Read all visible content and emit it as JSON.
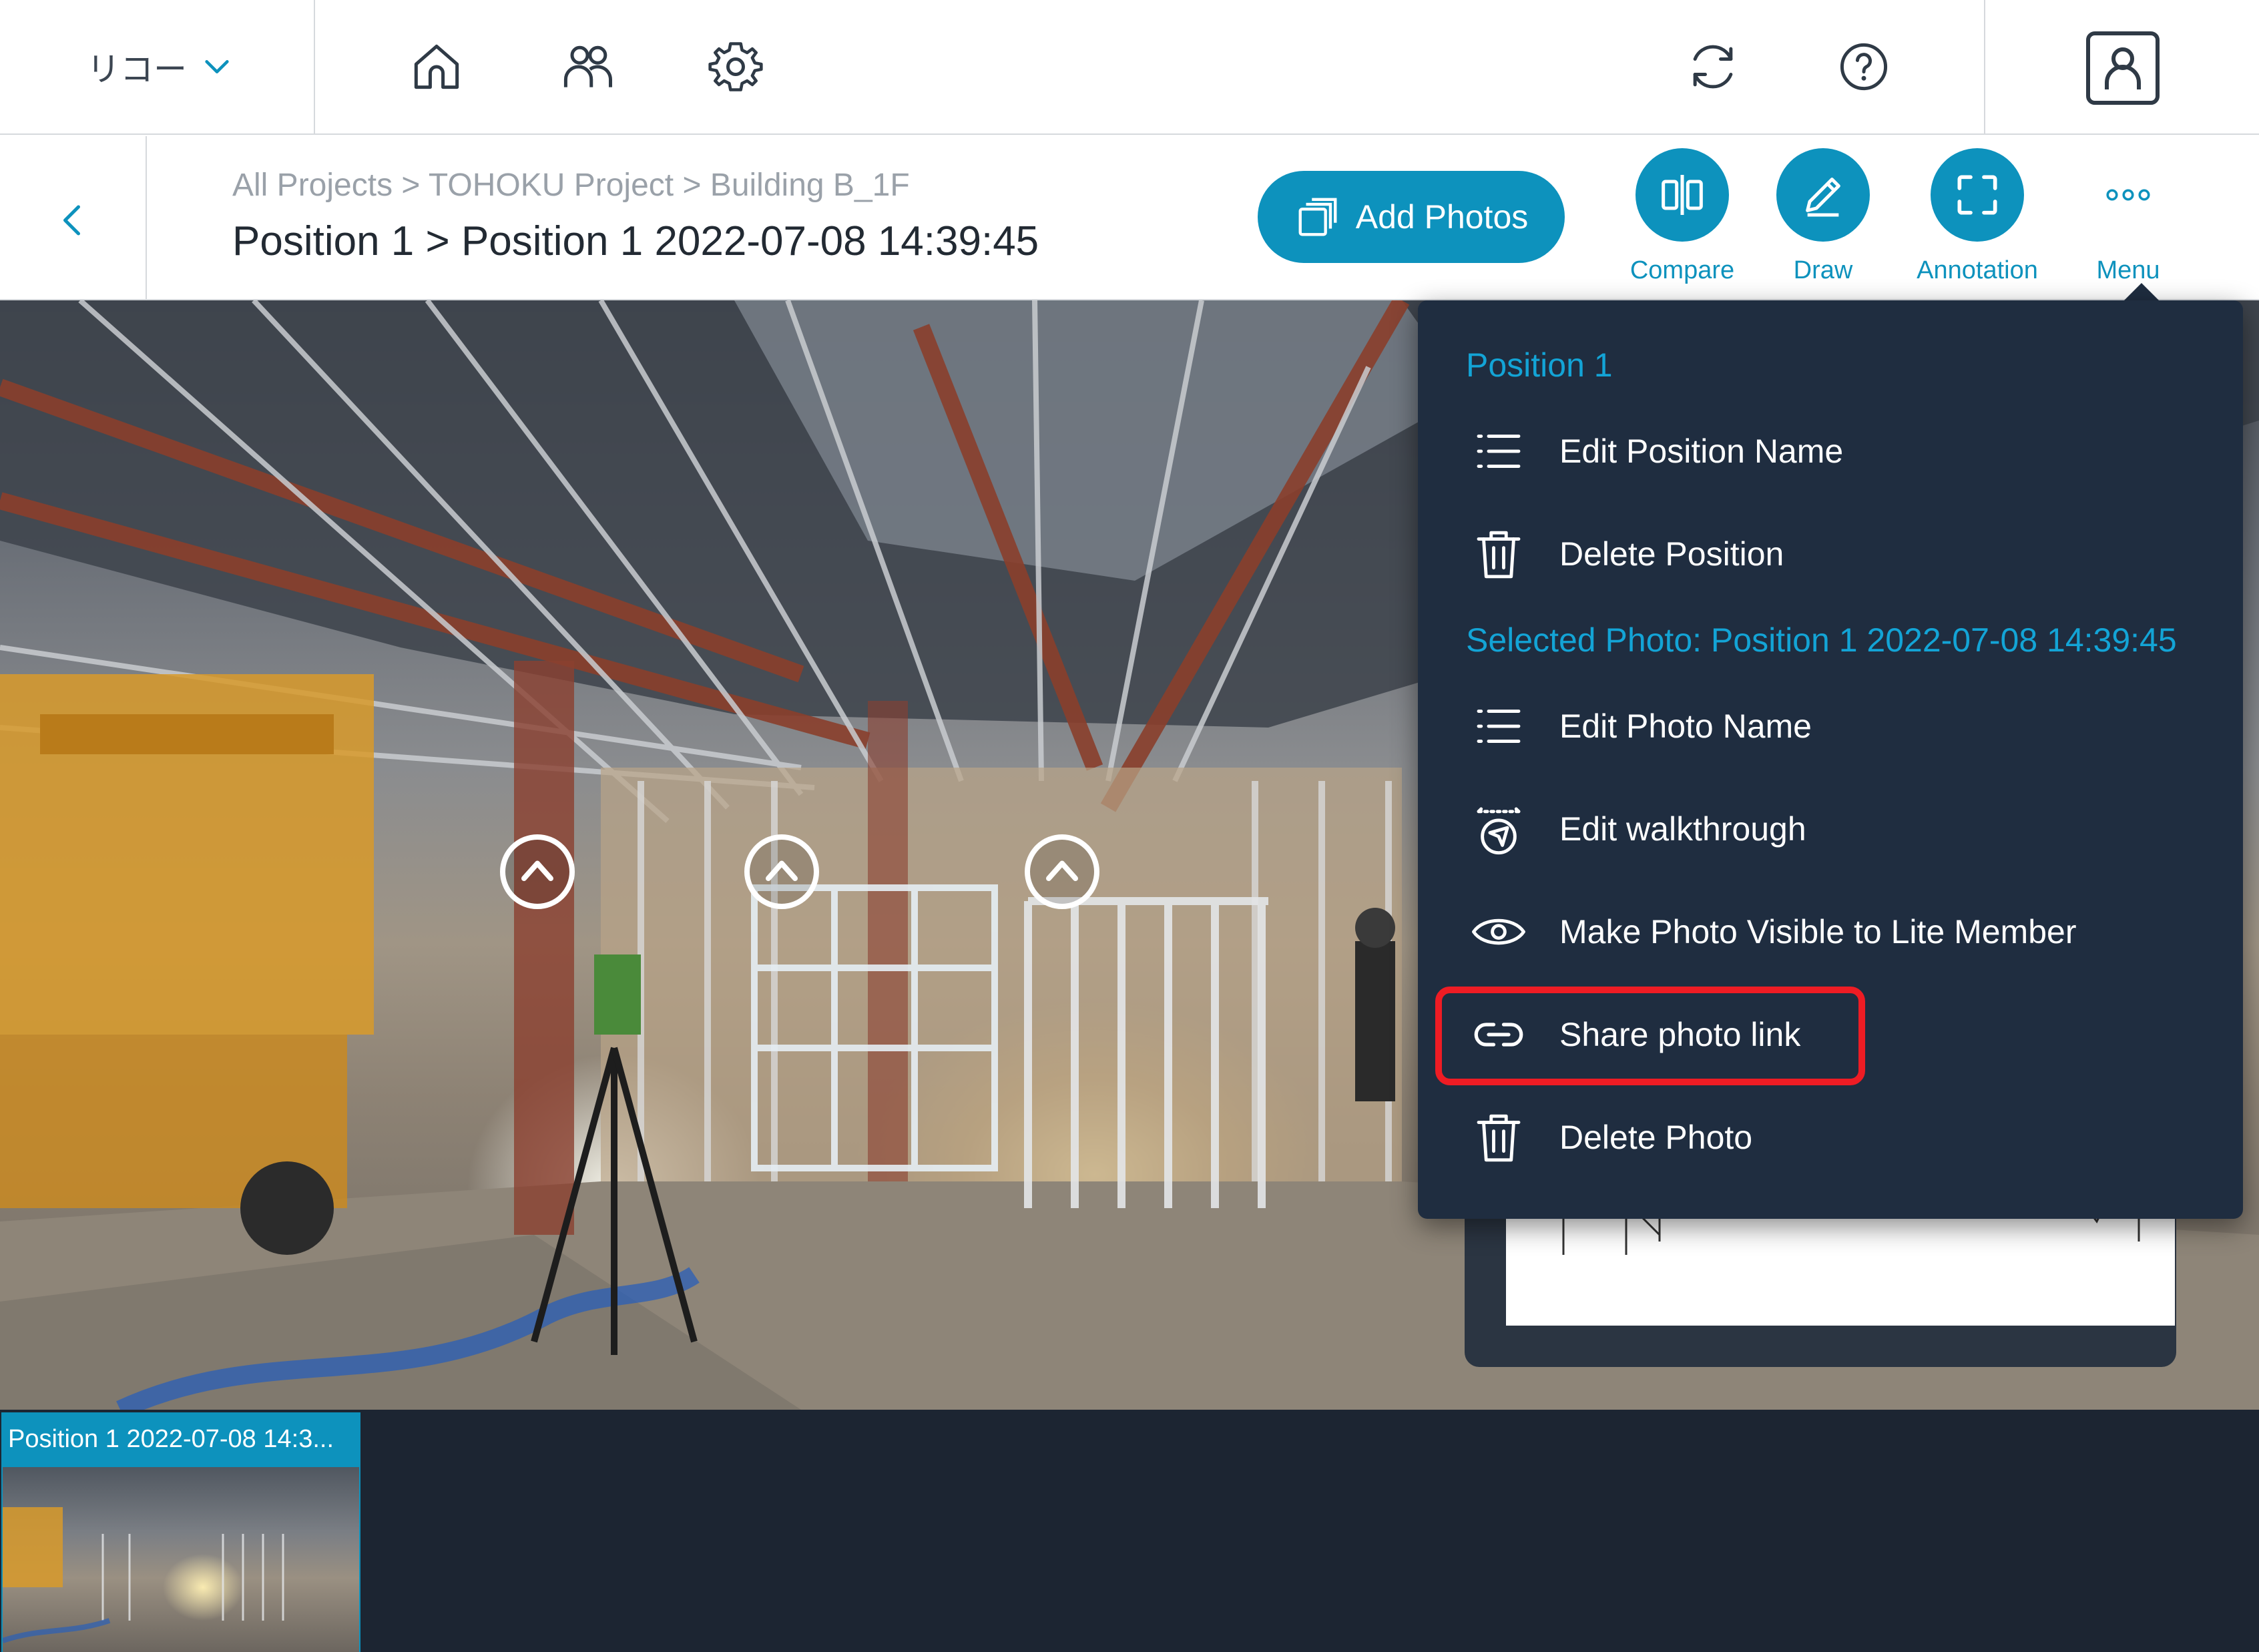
{
  "header": {
    "org_name": "リコー",
    "icons": [
      "home-icon",
      "users-icon",
      "gear-icon",
      "sync-icon",
      "help-icon",
      "profile-icon"
    ]
  },
  "subheader": {
    "breadcrumb": "All Projects > TOHOKU Project > Building B_1F",
    "title": "Position 1 > Position 1 2022-07-08 14:39:45",
    "add_photos_label": "Add Photos",
    "tools": {
      "compare": "Compare",
      "draw": "Draw",
      "annotation": "Annotation",
      "menu": "Menu"
    }
  },
  "menu": {
    "position_heading": "Position 1",
    "edit_position_name": "Edit Position Name",
    "delete_position": "Delete Position",
    "photo_heading": "Selected Photo: Position 1 2022-07-08 14:39:45",
    "edit_photo_name": "Edit Photo Name",
    "edit_walkthrough": "Edit walkthrough",
    "make_visible": "Make Photo Visible to Lite Member",
    "share_photo_link": "Share photo link",
    "delete_photo": "Delete Photo"
  },
  "thumbnail": {
    "label": "Position 1 2022-07-08 14:3..."
  },
  "colors": {
    "accent": "#0d92bd",
    "menu_bg": "#1f2d40",
    "highlight": "#ee1c24"
  }
}
